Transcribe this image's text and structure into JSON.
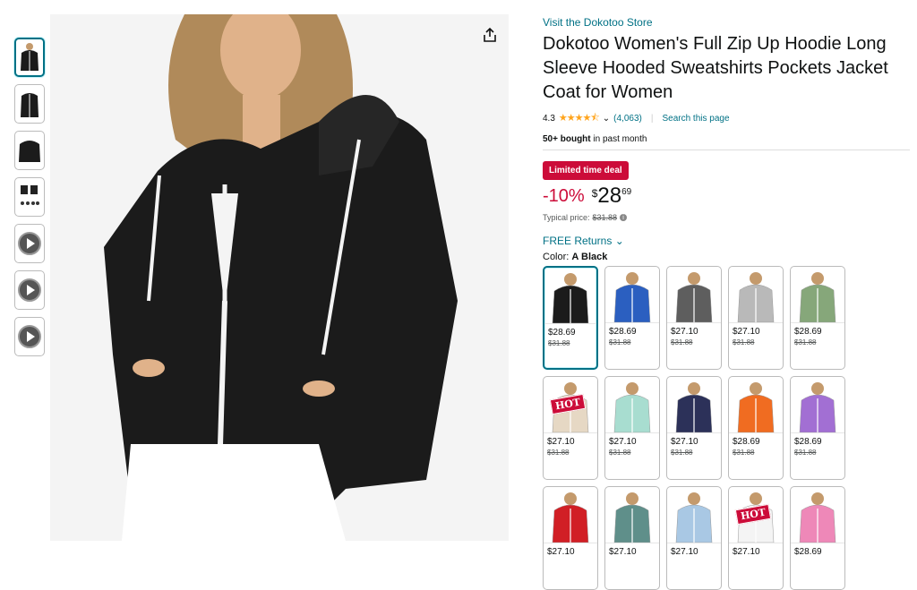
{
  "store_link": "Visit the Dokotoo Store",
  "title": "Dokotoo Women's Full Zip Up Hoodie Long Sleeve Hooded Sweatshirts Pockets Jacket Coat for Women",
  "rating": {
    "value": "4.3",
    "stars": "★★★★⯪",
    "count": "(4,063)",
    "search_link": "Search this page"
  },
  "bought": {
    "bold": "50+ bought",
    "rest": " in past month"
  },
  "deal_badge": "Limited time deal",
  "price": {
    "discount": "-10%",
    "currency": "$",
    "whole": "28",
    "fraction": "69",
    "typical_label": "Typical price:",
    "typical_value": "$31.88"
  },
  "returns": "FREE Returns",
  "color": {
    "label": "Color:",
    "selected": "A Black"
  },
  "swatches": [
    {
      "color": "#1b1b1b",
      "price": "$28.69",
      "old": "$31.88"
    },
    {
      "color": "#2b5fc0",
      "price": "$28.69",
      "old": "$31.88"
    },
    {
      "color": "#5e5e5e",
      "price": "$27.10",
      "old": "$31.88"
    },
    {
      "color": "#b9b9b9",
      "price": "$27.10",
      "old": "$31.88"
    },
    {
      "color": "#86a77a",
      "price": "$28.69",
      "old": "$31.88"
    },
    {
      "color": "#e6d8c4",
      "price": "$27.10",
      "old": "$31.88",
      "hot": "HOT"
    },
    {
      "color": "#a8ddd0",
      "price": "$27.10",
      "old": "$31.88"
    },
    {
      "color": "#2c3159",
      "price": "$27.10",
      "old": "$31.88"
    },
    {
      "color": "#f06c21",
      "price": "$28.69",
      "old": "$31.88"
    },
    {
      "color": "#a26fd3",
      "price": "$28.69",
      "old": "$31.88"
    },
    {
      "color": "#d11f25",
      "price": "$27.10"
    },
    {
      "color": "#5f8f8a",
      "price": "$27.10"
    },
    {
      "color": "#a9c8e4",
      "price": "$27.10"
    },
    {
      "color": "#f4f4f4",
      "price": "$27.10",
      "hot": "HOT"
    },
    {
      "color": "#ee88b8",
      "price": "$28.69"
    }
  ],
  "icons": {
    "share": "share-icon",
    "play": "play-icon"
  }
}
